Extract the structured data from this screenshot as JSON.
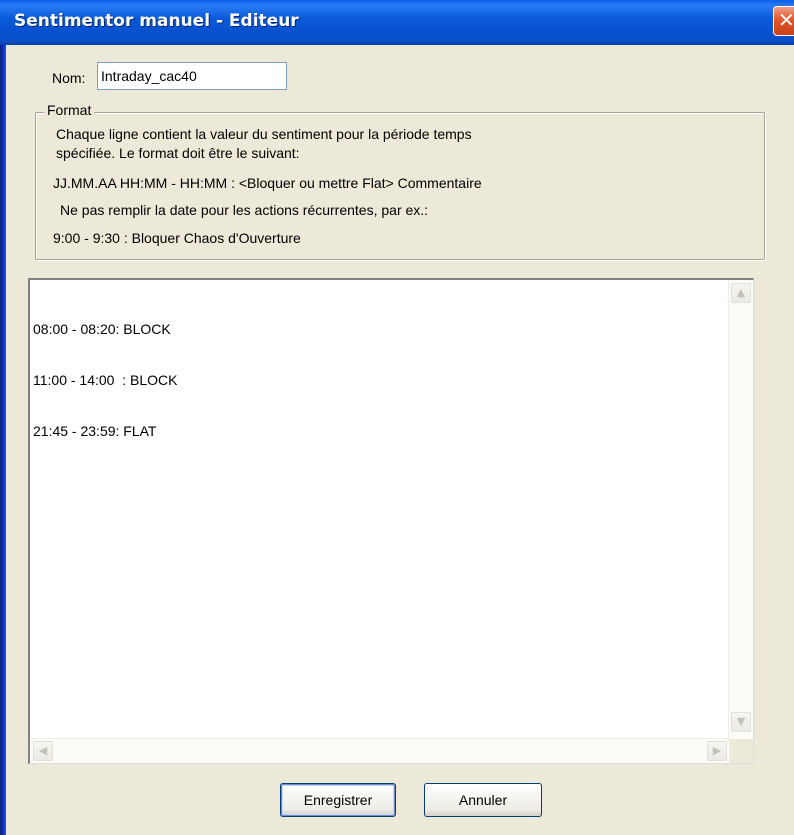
{
  "window": {
    "title": "Sentimentor manuel - Editeur",
    "close_glyph": "✕"
  },
  "name_field": {
    "label": "Nom:",
    "value": "Intraday_cac40"
  },
  "format_group": {
    "legend": "Format",
    "lines": [
      "Chaque ligne contient la valeur du sentiment pour la période temps",
      "spécifiée. Le format doit être le suivant:",
      "JJ.MM.AA HH:MM - HH:MM : <Bloquer ou mettre Flat> Commentaire",
      "Ne pas remplir la date pour les actions récurrentes, par ex.:",
      "9:00 - 9:30 : Bloquer  Chaos d'Ouverture"
    ]
  },
  "editor": {
    "lines": [
      "08:00 - 08:20: BLOCK",
      "11:00 - 14:00  : BLOCK",
      "21:45 - 23:59: FLAT"
    ],
    "scroll_up_glyph": "▲",
    "scroll_down_glyph": "▼",
    "scroll_left_glyph": "◀",
    "scroll_right_glyph": "▶"
  },
  "buttons": {
    "save_label": "Enregistrer",
    "cancel_label": "Annuler"
  },
  "colors": {
    "titlebar": "#0a5bd8",
    "window_bg": "#ece9d8",
    "close_button": "#e2562c"
  }
}
